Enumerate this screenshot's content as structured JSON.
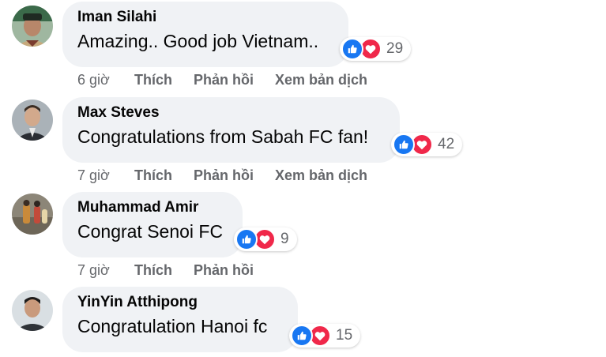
{
  "comments": [
    {
      "author": "Iman Silahi",
      "text": "Amazing.. Good job Vietnam..",
      "reaction_count": "29",
      "time": "6 giờ",
      "like_label": "Thích",
      "reply_label": "Phản hồi",
      "translate_label": "Xem bản dịch",
      "avatar_icon": "avatar-man-cap",
      "avatar_colors": [
        "#3b6a4a",
        "#b8a07a"
      ]
    },
    {
      "author": "Max Steves",
      "text": "Congratulations from Sabah FC fan!",
      "reaction_count": "42",
      "time": "7 giờ",
      "like_label": "Thích",
      "reply_label": "Phản hồi",
      "translate_label": "Xem bản dịch",
      "avatar_icon": "avatar-man-suit",
      "avatar_colors": [
        "#9aa3a8",
        "#2a2d33"
      ]
    },
    {
      "author": "Muhammad Amir",
      "text": "Congrat Senoi FC",
      "reaction_count": "9",
      "time": "7 giờ",
      "like_label": "Thích",
      "reply_label": "Phản hồi",
      "avatar_icon": "avatar-group-photo",
      "avatar_colors": [
        "#7a7466",
        "#c98a3a"
      ]
    },
    {
      "author": "YinYin Atthipong",
      "text": "Congratulation Hanoi fc",
      "reaction_count": "15",
      "avatar_icon": "avatar-man-portrait",
      "avatar_colors": [
        "#d9dfe3",
        "#2f3338"
      ]
    }
  ],
  "colors": {
    "bubble": "#f0f2f5",
    "like": "#1877f2",
    "love": "#f0284a",
    "meta": "#65676b"
  }
}
